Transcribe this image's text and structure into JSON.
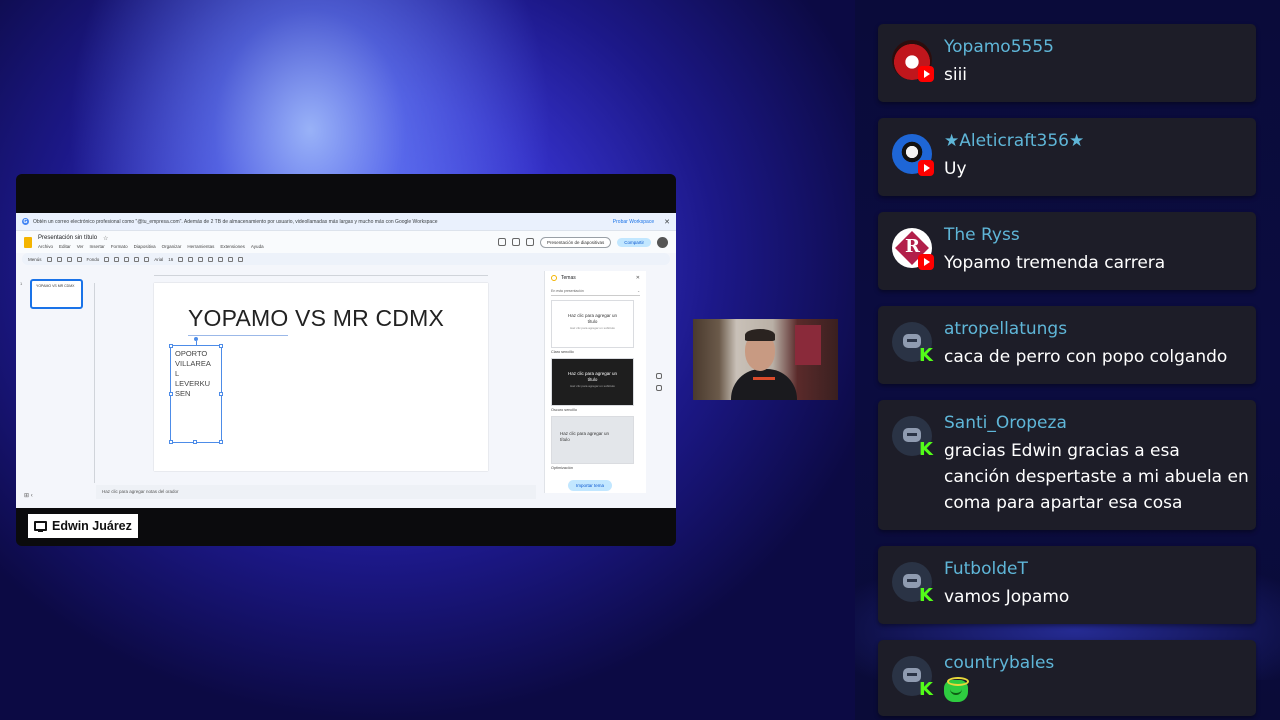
{
  "screen_share": {
    "banner_text": "Obtén un correo electrónico profesional como \"@tu_empresa.com\". Además de 2 TB de almacenamiento por usuario, videollamadas más largas y mucho más con Google Workspace",
    "banner_try": "Probar Workspace",
    "banner_close": "✕",
    "doc_title": "Presentación sin título",
    "menus": [
      "Archivo",
      "Editar",
      "Ver",
      "Insertar",
      "Formato",
      "Diapositiva",
      "Organizar",
      "Herramientas",
      "Extensiones",
      "Ayuda"
    ],
    "slideshow_label": "Presentación de diapositivas",
    "share_label": "Compartir",
    "toolbar": {
      "search_label": "Menús",
      "bg_label": "Fondo",
      "font_label": "Arial",
      "font_size": "16"
    },
    "thumb_num": "1",
    "thumb_text": "YOPAMO VS MR CDMX",
    "slide_title": "YOPAMO VS MR CDMX",
    "textbox_lines": [
      "OPORTO",
      "VILLAREA",
      "L",
      "LEVERKU",
      "SEN"
    ],
    "notes_placeholder": "Haz clic para agregar notas del orador",
    "themes": {
      "title": "Temas",
      "close": "✕",
      "source_label": "En esta presentación",
      "cards": [
        {
          "line1": "Haz clic para agregar un",
          "line2": "título",
          "line3": "Haz clic para agregar un subtítulo",
          "label": "Claro sencillo"
        },
        {
          "line1": "Haz clic para agregar un",
          "line2": "título",
          "line3": "Haz clic para agregar un subtítulo",
          "label": "Oscuro sencillo"
        },
        {
          "line1": "Haz clic para agregar un",
          "line2": "título",
          "line3": "",
          "label": "Optimización"
        }
      ],
      "import_label": "Importar tema"
    }
  },
  "presenter": {
    "name": "Edwin Juárez"
  },
  "chat": [
    {
      "username": "Yopamo5555",
      "message": "siii",
      "platform": "youtube",
      "avatar": "red"
    },
    {
      "username": "★Aleticraft356★",
      "message": "Uy",
      "platform": "youtube",
      "avatar": "blue"
    },
    {
      "username": "The Ryss",
      "message": "Yopamo tremenda carrera",
      "platform": "youtube",
      "avatar": "ryss"
    },
    {
      "username": "atropellatungs",
      "message": "caca de perro con popo colgando",
      "platform": "kick",
      "avatar": "bot"
    },
    {
      "username": "Santi_Oropeza",
      "message": "gracias Edwin gracias a esa canción despertaste a mi abuela en coma para apartar esa cosa",
      "platform": "kick",
      "avatar": "bot"
    },
    {
      "username": "FutboldeT",
      "message": "vamos Jopamo",
      "platform": "kick",
      "avatar": "bot"
    },
    {
      "username": "countrybales",
      "message": "",
      "platform": "kick",
      "avatar": "bot",
      "emote": "angel-emote"
    }
  ],
  "colors": {
    "username": "#5fb6d8",
    "chat_bg": "#1d1d28",
    "kick_green": "#53fc18",
    "youtube_red": "#ff0000"
  }
}
